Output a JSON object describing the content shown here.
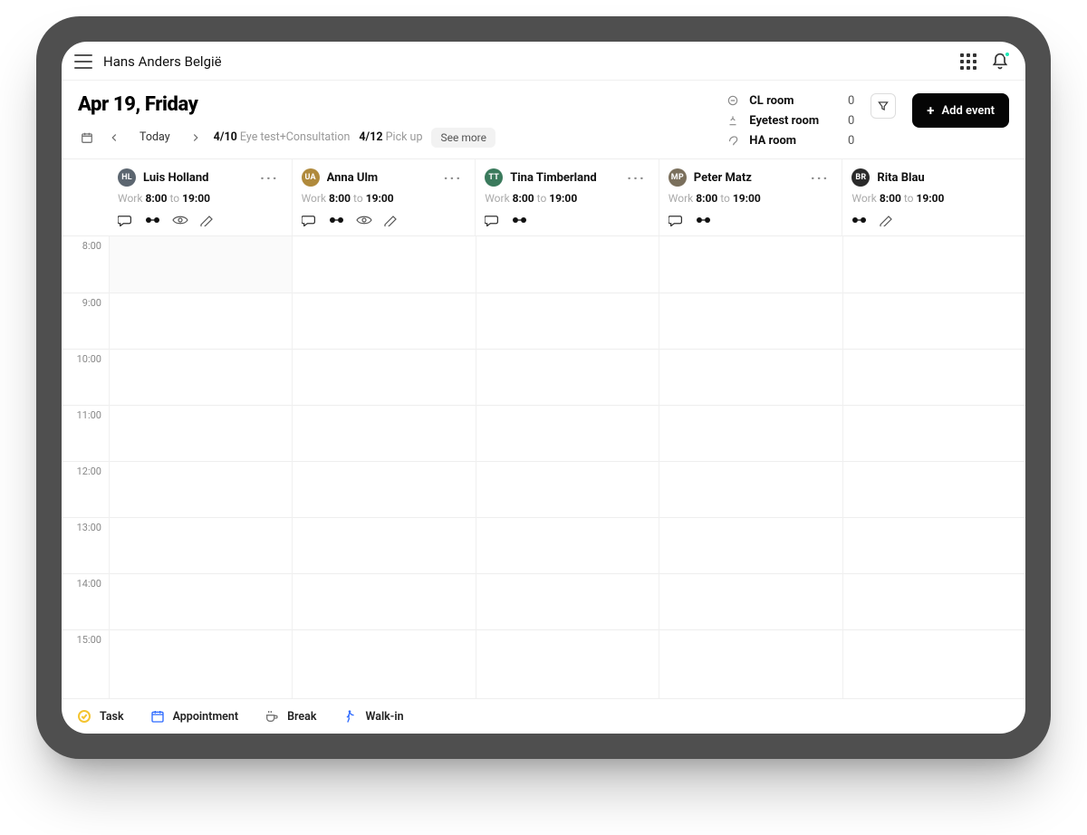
{
  "header": {
    "store_name": "Hans Anders België",
    "date_title": "Apr 19, Friday",
    "today_label": "Today",
    "nav_items": [
      {
        "date": "4/10",
        "label": "Eye test+Consultation"
      },
      {
        "date": "4/12",
        "label": "Pick up"
      }
    ],
    "see_more": "See more",
    "add_event": "Add event"
  },
  "rooms": [
    {
      "icon": "contacts",
      "name": "CL room",
      "count": "0"
    },
    {
      "icon": "eyetest",
      "name": "Eyetest room",
      "count": "0"
    },
    {
      "icon": "hearing",
      "name": "HA room",
      "count": "0"
    }
  ],
  "staff": [
    {
      "initials": "HL",
      "avatar_bg": "#5c6670",
      "name": "Luis Holland",
      "work_label": "Work",
      "start": "8:00",
      "to": "to",
      "end": "19:00",
      "more": true,
      "skills": [
        "bubble",
        "glasses",
        "eye",
        "pen"
      ]
    },
    {
      "initials": "UA",
      "avatar_bg": "#b08a3c",
      "name": "Anna Ulm",
      "work_label": "Work",
      "start": "8:00",
      "to": "to",
      "end": "19:00",
      "more": true,
      "skills": [
        "bubble",
        "glasses",
        "eye",
        "pen"
      ]
    },
    {
      "initials": "TT",
      "avatar_bg": "#3a7a5c",
      "name": "Tina Timberland",
      "work_label": "Work",
      "start": "8:00",
      "to": "to",
      "end": "19:00",
      "more": true,
      "skills": [
        "bubble",
        "glasses"
      ]
    },
    {
      "initials": "MP",
      "avatar_bg": "#7a6f5c",
      "name": "Peter Matz",
      "work_label": "Work",
      "start": "8:00",
      "to": "to",
      "end": "19:00",
      "more": true,
      "skills": [
        "bubble",
        "glasses"
      ]
    },
    {
      "initials": "BR",
      "avatar_bg": "#2a2a2a",
      "name": "Rita Blau",
      "work_label": "Work",
      "start": "8:00",
      "to": "to",
      "end": "19:00",
      "more": false,
      "skills": [
        "glasses",
        "pen"
      ]
    }
  ],
  "time_slots": [
    "8:00",
    "9:00",
    "10:00",
    "11:00",
    "12:00",
    "13:00",
    "14:00",
    "15:00"
  ],
  "legend": {
    "task": "Task",
    "appointment": "Appointment",
    "break": "Break",
    "walkin": "Walk-in"
  }
}
